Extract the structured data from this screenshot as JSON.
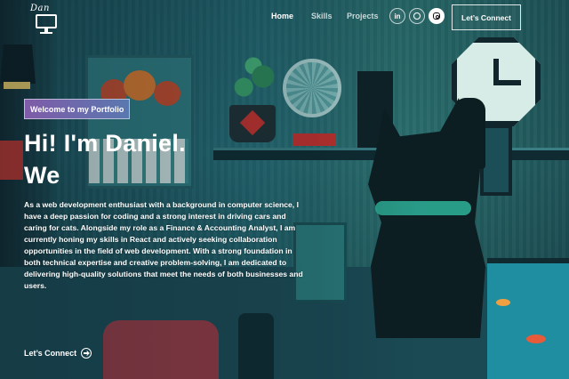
{
  "logo": {
    "script_text": "Dan",
    "icon": "monitor-icon"
  },
  "nav": {
    "links": [
      {
        "label": "Home",
        "active": true
      },
      {
        "label": "Skills",
        "active": false
      },
      {
        "label": "Projects",
        "active": false
      }
    ],
    "social": [
      {
        "label": "in",
        "icon": "linkedin-icon"
      },
      {
        "label": "",
        "icon": "facebook-icon"
      },
      {
        "label": "",
        "icon": "instagram-icon"
      }
    ],
    "connect_button": "Let’s Connect"
  },
  "hero": {
    "tagline": "Welcome to my Portfolio",
    "title_line1": "Hi! I'm Daniel.",
    "title_line2": "We",
    "bio": "As a web development enthusiast with a background in computer science, I have a deep passion for coding and a strong interest in driving cars and caring for cats. Alongside my role as a Finance & Accounting Analyst, I am currently honing my skills in React and actively seeking collaboration opportunities in the field of web development. With a strong foundation in both technical expertise and creative problem-solving, I am dedicated to delivering high-quality solutions that meet the needs of both businesses and users.",
    "cta": "Let’s Connect",
    "cta_icon": "arrow-right-circle-icon"
  },
  "colors": {
    "tagline_gradient_start": "#7f5ba8",
    "tagline_gradient_end": "#5a78b0",
    "background": "#1d5a5e"
  }
}
